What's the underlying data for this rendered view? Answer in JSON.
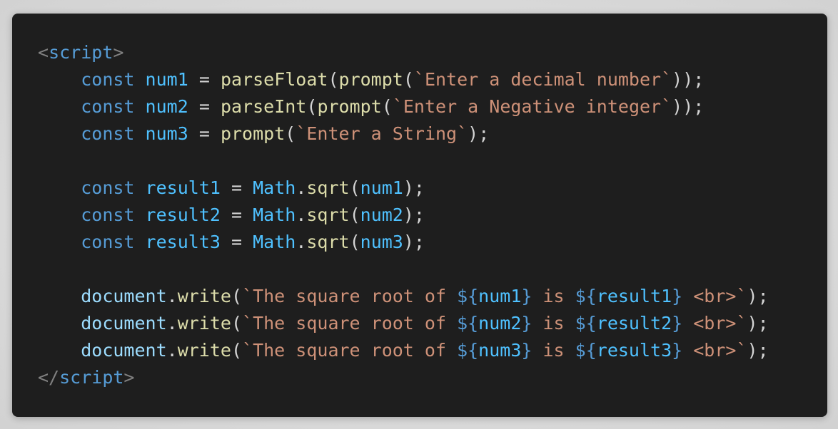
{
  "code": {
    "open_tag": "script",
    "close_tag": "script",
    "keyword": "const",
    "line1": {
      "name": "num1",
      "call1": "parseFloat",
      "call2": "prompt",
      "str": "`Enter a decimal number`"
    },
    "line2": {
      "name": "num2",
      "call1": "parseInt",
      "call2": "prompt",
      "str": "`Enter a Negative integer`"
    },
    "line3": {
      "name": "num3",
      "call2": "prompt",
      "str": "`Enter a String`"
    },
    "line4": {
      "name": "result1",
      "obj": "Math",
      "method": "sqrt",
      "arg": "num1"
    },
    "line5": {
      "name": "result2",
      "obj": "Math",
      "method": "sqrt",
      "arg": "num2"
    },
    "line6": {
      "name": "result3",
      "obj": "Math",
      "method": "sqrt",
      "arg": "num3"
    },
    "writes": [
      {
        "obj": "document",
        "method": "write",
        "str_start": "`The square root of ",
        "num": "num1",
        "is": " is ",
        "res": "result1",
        "str_end": " <br>`"
      },
      {
        "obj": "document",
        "method": "write",
        "str_start": "`The square root of ",
        "num": "num2",
        "is": " is ",
        "res": "result2",
        "str_end": " <br>`"
      },
      {
        "obj": "document",
        "method": "write",
        "str_start": "`The square root of ",
        "num": "num3",
        "is": " is ",
        "res": "result3",
        "str_end": " <br>`"
      }
    ]
  }
}
